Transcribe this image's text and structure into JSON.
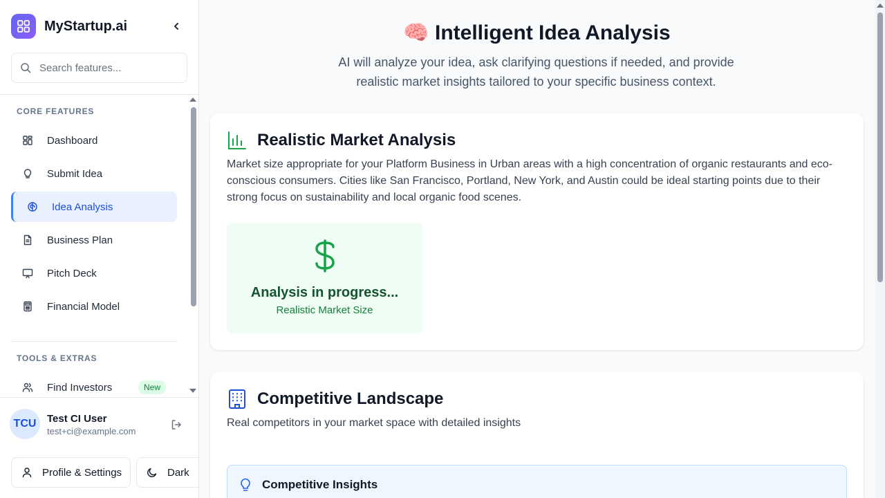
{
  "app": {
    "name": "MyStartup.ai"
  },
  "search": {
    "placeholder": "Search features..."
  },
  "sidebar": {
    "core_title": "CORE FEATURES",
    "core_items": [
      {
        "label": "Dashboard",
        "icon": "grid-icon"
      },
      {
        "label": "Submit Idea",
        "icon": "lightbulb-icon"
      },
      {
        "label": "Idea Analysis",
        "icon": "brain-icon",
        "active": true
      },
      {
        "label": "Business Plan",
        "icon": "document-icon"
      },
      {
        "label": "Pitch Deck",
        "icon": "presentation-icon"
      },
      {
        "label": "Financial Model",
        "icon": "calculator-icon"
      }
    ],
    "tools_title": "TOOLS & EXTRAS",
    "tools_items": [
      {
        "label": "Find Investors",
        "icon": "users-icon",
        "badge": "New"
      }
    ]
  },
  "user": {
    "initials": "TCU",
    "name": "Test CI User",
    "email": "test+ci@example.com"
  },
  "footer_buttons": {
    "profile": "Profile & Settings",
    "dark": "Dark"
  },
  "page": {
    "emoji": "🧠",
    "title": "Intelligent Idea Analysis",
    "subtitle": "AI will analyze your idea, ask clarifying questions if needed, and provide realistic market insights tailored to your specific business context."
  },
  "market": {
    "title": "Realistic Market Analysis",
    "description": "Market size appropriate for your Platform Business in Urban areas with a high concentration of organic restaurants and eco-conscious consumers. Cities like San Francisco, Portland, New York, and Austin could be ideal starting points due to their strong focus on sustainability and local organic food scenes.",
    "stat_value": "Analysis in progress...",
    "stat_label": "Realistic Market Size"
  },
  "competition": {
    "title": "Competitive Landscape",
    "description": "Real competitors in your market space with detailed insights",
    "insights_title": "Competitive Insights"
  },
  "colors": {
    "accent": "#3b82f6",
    "active_bg": "#e8f0fe",
    "green": "#16a34a",
    "brand_gradient_start": "#6366f1",
    "brand_gradient_end": "#8b5cf6"
  }
}
